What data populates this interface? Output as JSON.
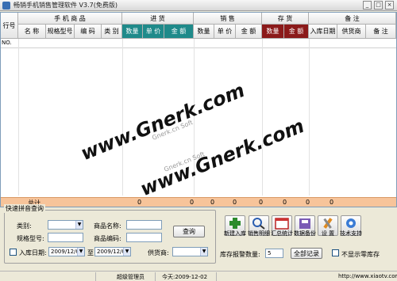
{
  "window": {
    "title": "畅销手机销售管理软件 V3.7(免费版)",
    "min_glyph": "_",
    "max_glyph": "□",
    "close_glyph": "×"
  },
  "grid": {
    "row_no_header": "行号",
    "groups": [
      "手 机 商 品",
      "进 货",
      "销 售",
      "存 货",
      "备 注"
    ],
    "columns": [
      "名 称",
      "规格型号",
      "编 码",
      "类 别",
      "数量",
      "单 价",
      "金 额",
      "数量",
      "单 价",
      "金 额",
      "数量",
      "金 额",
      "入库日期",
      "供货商",
      "备 注"
    ],
    "first_row_no": "NO.",
    "total_label": "总计",
    "totals": [
      "0",
      "0",
      "0",
      "0",
      "0",
      "0",
      "0",
      "0"
    ]
  },
  "watermark": {
    "main": "www.Gnerk.com",
    "sub": "Gnerk.cn Soft"
  },
  "search": {
    "title": "快速拼音查询",
    "category_label": "类别:",
    "category_value": "",
    "name_label": "商品名称:",
    "name_value": "",
    "model_label": "规格型号:",
    "model_value": "",
    "code_label": "商品编码:",
    "code_value": "",
    "query_button": "查询",
    "date_label": "入库日期:",
    "date_from": "2009/12/02",
    "to_label": "至",
    "date_to": "2009/12/02",
    "supplier_label": "供货商:",
    "supplier_value": ""
  },
  "toolbar": {
    "items": [
      {
        "label": "新建入库",
        "icon": "plus-icon"
      },
      {
        "label": "销售明细",
        "icon": "magnifier-icon"
      },
      {
        "label": "汇总统计",
        "icon": "calendar-icon"
      },
      {
        "label": "数据备份",
        "icon": "backup-icon"
      },
      {
        "label": "设 置",
        "icon": "tools-icon"
      },
      {
        "label": "技术支持",
        "icon": "support-icon"
      }
    ]
  },
  "stock": {
    "alarm_label": "库存报警数量:",
    "alarm_value": "5",
    "all_records_button": "全部记录",
    "hide_zero_label": "不显示零库存"
  },
  "status": {
    "user": "超级管理员",
    "today": "今天:2009-12-02",
    "site": "http://www.xiaotv.com"
  },
  "colors": {
    "teal_header": "#1f8a8a",
    "maroon_header": "#8b1a1a",
    "total_bar": "#f7c49a"
  }
}
